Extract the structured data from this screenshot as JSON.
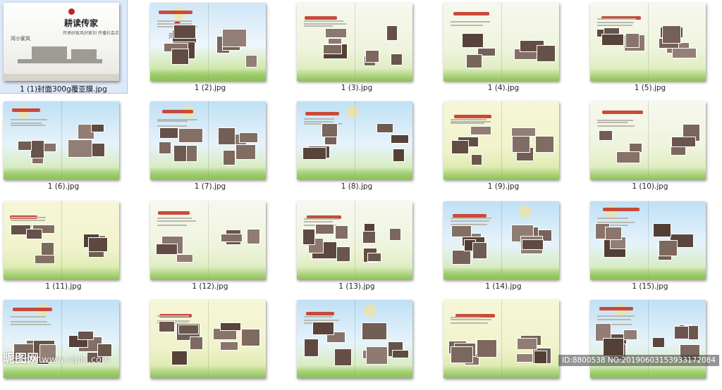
{
  "file_grid": {
    "items": [
      {
        "name": "1 (1)封面300g覆亚膜.jpg",
        "selected": true,
        "style": "cover"
      },
      {
        "name": "1 (2).jpg",
        "style": "garden"
      },
      {
        "name": "1 (3).jpg",
        "style": "green"
      },
      {
        "name": "1 (4).jpg",
        "style": "green"
      },
      {
        "name": "1 (5).jpg",
        "style": "green"
      },
      {
        "name": "1 (6).jpg",
        "style": "sky"
      },
      {
        "name": "1 (7).jpg",
        "style": "sky"
      },
      {
        "name": "1 (8).jpg",
        "style": "sky"
      },
      {
        "name": "1 (9).jpg",
        "style": "yellow"
      },
      {
        "name": "1 (10).jpg",
        "style": "green"
      },
      {
        "name": "1 (11).jpg",
        "style": "yellow"
      },
      {
        "name": "1 (12).jpg",
        "style": "green"
      },
      {
        "name": "1 (13).jpg",
        "style": "green"
      },
      {
        "name": "1 (14).jpg",
        "style": "sky"
      },
      {
        "name": "1 (15).jpg",
        "style": "sky"
      },
      {
        "name": "",
        "style": "sky"
      },
      {
        "name": "",
        "style": "yellow"
      },
      {
        "name": "",
        "style": "sky"
      },
      {
        "name": "",
        "style": "yellow"
      },
      {
        "name": "",
        "style": "sky"
      }
    ]
  },
  "cover": {
    "title": "耕读传家",
    "subtitle": "传承好家风好家训 传播社会正能量",
    "brand": "河小家风"
  },
  "page2_label": "河小家训",
  "watermark": {
    "logo": "昵图网",
    "url": "www.nipic.com",
    "id_text": "ID:8800538 NO:20190603153933172084"
  },
  "colors": {
    "selection": "#dde9f8",
    "title_red": "#c94a3a",
    "grass": "#8fc35a"
  }
}
